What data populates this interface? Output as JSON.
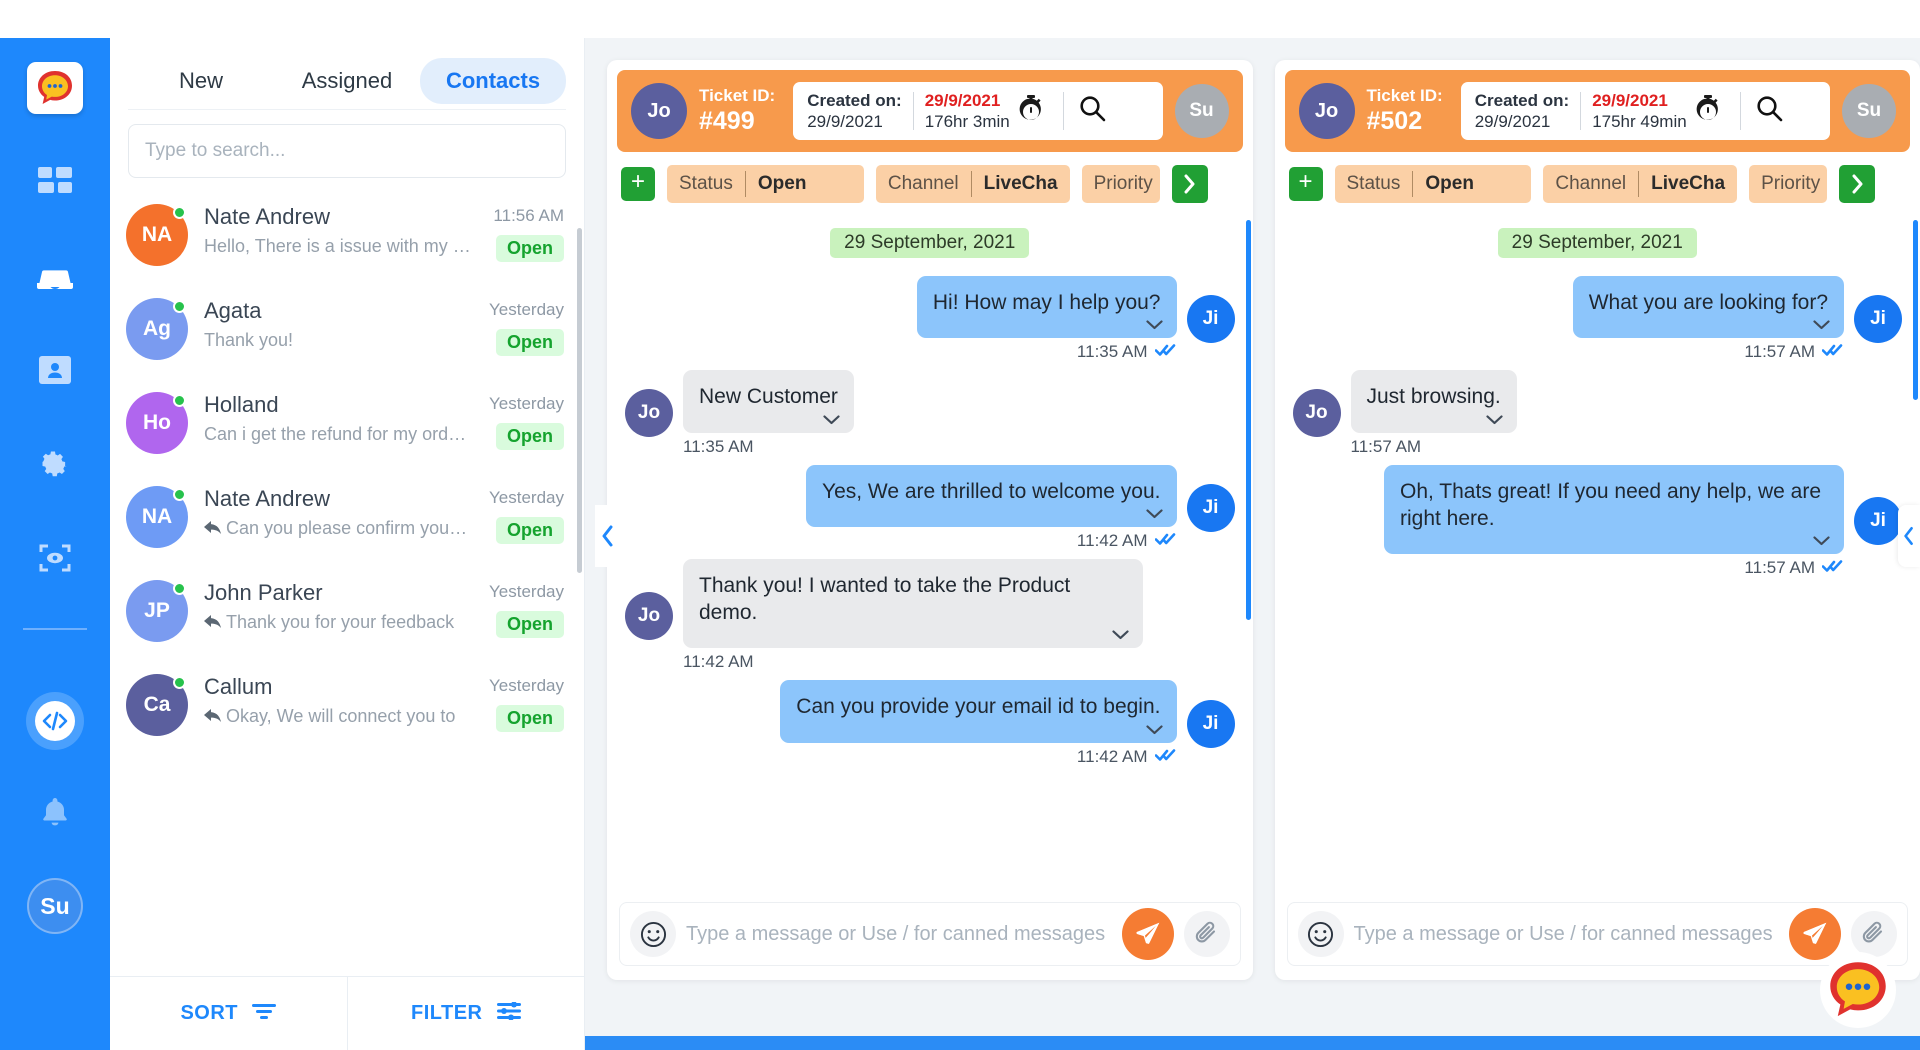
{
  "sidebar": {
    "logo_icon": "chat-bubble-logo",
    "items": [
      {
        "name": "dashboard",
        "icon": "grid-icon"
      },
      {
        "name": "inbox",
        "icon": "inbox-icon"
      },
      {
        "name": "contacts",
        "icon": "contact-card-icon"
      },
      {
        "name": "settings",
        "icon": "gear-icon"
      },
      {
        "name": "monitor",
        "icon": "eye-scan-icon"
      }
    ],
    "code_icon": "code-icon",
    "bell_icon": "bell-icon",
    "user_initials": "Su"
  },
  "contacts_panel": {
    "tabs": [
      {
        "label": "New",
        "active": false
      },
      {
        "label": "Assigned",
        "active": false
      },
      {
        "label": "Contacts",
        "active": true
      }
    ],
    "search": {
      "placeholder": "Type to search...",
      "value": ""
    },
    "rows": [
      {
        "initials": "NA",
        "color": "#f4712c",
        "name": "Nate Andrew",
        "preview": "Hello, There is a issue with my …",
        "time": "11:56 AM",
        "badge": "Open",
        "reply": false
      },
      {
        "initials": "Ag",
        "color": "#7a9bf0",
        "name": "Agata",
        "preview": "Thank you!",
        "time": "Yesterday",
        "badge": "Open",
        "reply": false
      },
      {
        "initials": "Ho",
        "color": "#b066ee",
        "name": "Holland",
        "preview": "Can i get the refund for my ord…",
        "time": "Yesterday",
        "badge": "Open",
        "reply": false
      },
      {
        "initials": "NA",
        "color": "#6e9bf5",
        "name": "Nate Andrew",
        "preview": "Can you please confirm you…",
        "time": "Yesterday",
        "badge": "Open",
        "reply": true
      },
      {
        "initials": "JP",
        "color": "#7a9bf0",
        "name": "John Parker",
        "preview": "Thank you for your feedback",
        "time": "Yesterday",
        "badge": "Open",
        "reply": true
      },
      {
        "initials": "Ca",
        "color": "#5b5f9e",
        "name": "Callum",
        "preview": "Okay, We will connect you to",
        "time": "Yesterday",
        "badge": "Open",
        "reply": true
      }
    ],
    "footer": {
      "sort_label": "SORT",
      "sort_icon": "sort-icon",
      "filter_label": "FILTER",
      "filter_icon": "filter-icon"
    }
  },
  "chats": [
    {
      "avatar_initials": "Jo",
      "ticket_label": "Ticket ID:",
      "ticket_number": "#499",
      "created_label": "Created on:",
      "created_date_red": "29/9/2021",
      "created_date": "29/9/2021",
      "elapsed": "176hr 3min",
      "stopwatch_icon": "stopwatch-icon",
      "search_icon": "search-icon",
      "agent_initials": "Su",
      "tags": {
        "add_label": "+",
        "status_key": "Status",
        "status_value": "Open",
        "channel_key": "Channel",
        "channel_value": "LiveCha",
        "priority_key": "Priority",
        "next_icon": "chevron-right-icon"
      },
      "date_chip": "29 September, 2021",
      "messages": [
        {
          "side": "out",
          "text": "Hi! How may I help you?",
          "time": "11:35 AM",
          "avatar": "Ji",
          "read": true
        },
        {
          "side": "in",
          "text": "New Customer",
          "time": "11:35 AM",
          "avatar": "Jo",
          "read": false
        },
        {
          "side": "out",
          "text": "Yes, We are thrilled to welcome you.",
          "time": "11:42 AM",
          "avatar": "Ji",
          "read": true
        },
        {
          "side": "in",
          "text": "Thank you! I wanted to take the Product demo.",
          "time": "11:42 AM",
          "avatar": "Jo",
          "read": false
        },
        {
          "side": "out",
          "text": "Can you provide your email id to begin.",
          "time": "11:42 AM",
          "avatar": "Ji",
          "read": true
        }
      ],
      "composer": {
        "emoji_icon": "emoji-icon",
        "placeholder": "Type a message or Use / for canned messages",
        "value": "",
        "send_icon": "send-icon",
        "attach_icon": "paperclip-icon"
      }
    },
    {
      "avatar_initials": "Jo",
      "ticket_label": "Ticket ID:",
      "ticket_number": "#502",
      "created_label": "Created on:",
      "created_date_red": "29/9/2021",
      "created_date": "29/9/2021",
      "elapsed": "175hr 49min",
      "stopwatch_icon": "stopwatch-icon",
      "search_icon": "search-icon",
      "agent_initials": "Su",
      "tags": {
        "add_label": "+",
        "status_key": "Status",
        "status_value": "Open",
        "channel_key": "Channel",
        "channel_value": "LiveCha",
        "priority_key": "Priority",
        "next_icon": "chevron-right-icon"
      },
      "date_chip": "29 September, 2021",
      "messages": [
        {
          "side": "out",
          "text": "What you are looking for?",
          "time": "11:57 AM",
          "avatar": "Ji",
          "read": true
        },
        {
          "side": "in",
          "text": "Just browsing.",
          "time": "11:57 AM",
          "avatar": "Jo",
          "read": false
        },
        {
          "side": "out",
          "text": "Oh, Thats great! If you need any help, we are right here.",
          "time": "11:57 AM",
          "avatar": "Ji",
          "read": true
        }
      ],
      "composer": {
        "emoji_icon": "emoji-icon",
        "placeholder": "Type a message or Use / for canned messages",
        "value": "",
        "send_icon": "send-icon",
        "attach_icon": "paperclip-icon"
      }
    }
  ],
  "collapse_left_icon": "chevron-left-icon",
  "collapse_right_icon": "chevron-left-icon",
  "fab_icon": "chat-bubble-logo",
  "colors": {
    "brand_blue": "#1e88fc",
    "header_orange": "#f79a4c",
    "tag_peach": "#fbd0a6",
    "green": "#21a034",
    "badge_green_bg": "#d9fbdd",
    "badge_green_text": "#15a32e",
    "bubble_out": "#8cc5fb",
    "bubble_in": "#e9eaec",
    "date_chip": "#c9f2bd",
    "send_orange": "#f57c33"
  }
}
